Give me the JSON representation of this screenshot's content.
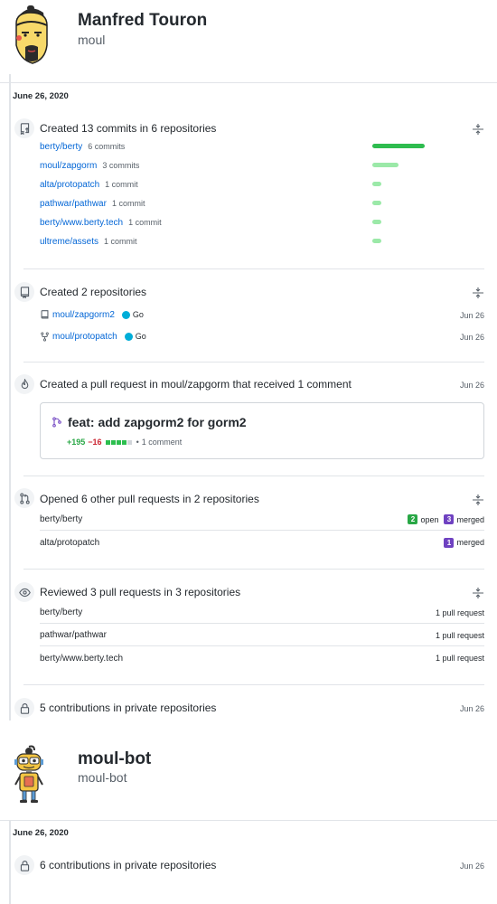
{
  "profiles": [
    {
      "name": "Manfred Touron",
      "login": "moul",
      "date": "June 26, 2020",
      "commits": {
        "title": "Created 13 commits in 6 repositories",
        "rows": [
          {
            "repo": "berty/berty",
            "count": "6 commits",
            "share": 6
          },
          {
            "repo": "moul/zapgorm",
            "count": "3 commits",
            "share": 3
          },
          {
            "repo": "alta/protopatch",
            "count": "1 commit",
            "share": 1
          },
          {
            "repo": "pathwar/pathwar",
            "count": "1 commit",
            "share": 1
          },
          {
            "repo": "berty/www.berty.tech",
            "count": "1 commit",
            "share": 1
          },
          {
            "repo": "ultreme/assets",
            "count": "1 commit",
            "share": 1
          }
        ]
      },
      "repos_created": {
        "title": "Created 2 repositories",
        "rows": [
          {
            "repo": "moul/zapgorm2",
            "lang": "Go",
            "date": "Jun 26",
            "icon": "repo-icon"
          },
          {
            "repo": "moul/protopatch",
            "lang": "Go",
            "date": "Jun 26",
            "icon": "fork-icon"
          }
        ]
      },
      "pr_created": {
        "title_prefix": "Created a pull request in ",
        "title_repo": "moul/zapgorm",
        "title_suffix": " that received 1 comment",
        "date": "Jun 26",
        "pr_title": "feat: add zapgorm2 for gorm2",
        "additions": "+195",
        "deletions": "−16",
        "comments": "1 comment"
      },
      "opened_prs": {
        "title": "Opened 6 other pull requests in 2 repositories",
        "rows": [
          {
            "repo": "berty/berty",
            "open_count": "2",
            "open_label": "open",
            "merged_count": "3",
            "merged_label": "merged"
          },
          {
            "repo": "alta/protopatch",
            "merged_count": "1",
            "merged_label": "merged"
          }
        ]
      },
      "reviewed": {
        "title": "Reviewed 3 pull requests in 3 repositories",
        "rows": [
          {
            "repo": "berty/berty",
            "count": "1 pull request"
          },
          {
            "repo": "pathwar/pathwar",
            "count": "1 pull request"
          },
          {
            "repo": "berty/www.berty.tech",
            "count": "1 pull request"
          }
        ]
      },
      "private": {
        "title": "5 contributions in private repositories",
        "date": "Jun 26"
      }
    },
    {
      "name": "moul-bot",
      "login": "moul-bot",
      "date": "June 26, 2020",
      "private": {
        "title": "6 contributions in private repositories",
        "date": "Jun 26"
      }
    }
  ],
  "colors": {
    "link": "#0366d6",
    "bar_strong": "#2ebc4f",
    "bar_light": "#9be9a8",
    "open": "#28a745",
    "merged": "#6f42c1",
    "go": "#00ADD8",
    "add": "#28a745",
    "del": "#cb2431"
  }
}
